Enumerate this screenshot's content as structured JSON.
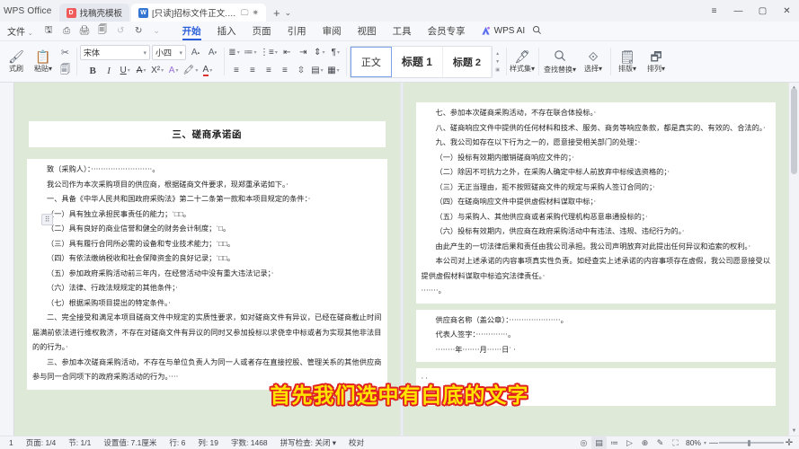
{
  "window": {
    "app_name": "WPS Office",
    "controls": {
      "minimize": "—",
      "maximize": "▢",
      "close": "✕",
      "menu": "≡"
    }
  },
  "tabs": [
    {
      "label": "找稿壳模板",
      "icon": "template-doc-icon",
      "kind": "pdfish",
      "active": false
    },
    {
      "label": "[只读]招标文件正文.docx",
      "icon": "word-doc-icon",
      "kind": "word",
      "active": true
    }
  ],
  "tab_actions": {
    "new_tab": "+",
    "tab_list": "⌄",
    "monitor": "🖵",
    "star": "✷"
  },
  "menu": {
    "file_label": "文件",
    "file_caret": "⌄",
    "quick_access": [
      {
        "name": "save-icon",
        "glyph": "🖫",
        "dim": false
      },
      {
        "name": "print-preview-icon",
        "glyph": "⎙",
        "dim": false
      },
      {
        "name": "print-icon",
        "glyph": "🖨",
        "dim": false
      },
      {
        "name": "print-direct-icon",
        "glyph": "🗐",
        "dim": false
      },
      {
        "name": "undo-icon",
        "glyph": "↺",
        "dim": true
      },
      {
        "name": "redo-icon",
        "glyph": "↻",
        "dim": false
      },
      {
        "name": "qat-more-icon",
        "glyph": "⌄",
        "dim": false
      }
    ],
    "ribbon_tabs": [
      {
        "label": "开始",
        "active": true
      },
      {
        "label": "插入",
        "active": false
      },
      {
        "label": "页面",
        "active": false
      },
      {
        "label": "引用",
        "active": false
      },
      {
        "label": "审阅",
        "active": false
      },
      {
        "label": "视图",
        "active": false
      },
      {
        "label": "工具",
        "active": false
      },
      {
        "label": "会员专享",
        "active": false
      }
    ],
    "ai": {
      "label": "WPS AI",
      "icon": "wps-ai-icon"
    },
    "search": {
      "icon": "search-icon",
      "glyph": "🔍"
    }
  },
  "ribbon": {
    "clipboard": {
      "format_brush": {
        "label": "式刷",
        "glyph": "🖌"
      },
      "paste": {
        "label": "粘贴",
        "glyph": "📋",
        "caret": "▾"
      },
      "cut": {
        "glyph": "✂"
      },
      "copy": {
        "glyph": "🗐"
      }
    },
    "font": {
      "family_value": "宋体",
      "size_value": "小四",
      "grow_glyph": "A",
      "shrink_glyph": "A",
      "buttons": [
        {
          "name": "bold-button",
          "glyph": "B"
        },
        {
          "name": "italic-button",
          "glyph": "I"
        },
        {
          "name": "underline-button",
          "glyph": "U"
        },
        {
          "name": "strikethrough-button",
          "glyph": "A"
        },
        {
          "name": "superscript-button",
          "glyph": "X²"
        },
        {
          "name": "text-effects-button",
          "glyph": "A"
        },
        {
          "name": "highlight-color-button",
          "glyph": "🖍"
        },
        {
          "name": "font-color-button",
          "glyph": "A"
        }
      ]
    },
    "paragraph": {
      "row1": [
        "≣",
        "≔",
        "⋮≡",
        "⇤",
        "⇥",
        "⇕",
        "¶"
      ],
      "row2": [
        "≡",
        "≡",
        "≡",
        "≡",
        "⇳",
        "▤",
        "▦"
      ]
    },
    "styles": {
      "items": [
        {
          "label": "正文",
          "selected": true
        },
        {
          "label": "标题 1",
          "selected": false
        },
        {
          "label": "标题 2",
          "selected": false
        }
      ],
      "scroll_up": "▲",
      "scroll_down": "▼",
      "scroll_more": "▣"
    },
    "right_tools": [
      {
        "label": "样式集",
        "glyph": "🖋",
        "caret": "▾",
        "name": "style-set-button"
      },
      {
        "label": "查找替换",
        "glyph": "🔍",
        "caret": "▾",
        "name": "find-replace-button"
      },
      {
        "label": "选择",
        "glyph": "⌖",
        "caret": "▾",
        "name": "select-button"
      },
      {
        "label": "排版",
        "glyph": "🗒",
        "caret": "▾",
        "name": "typeset-button"
      },
      {
        "label": "排列",
        "glyph": "🗗",
        "caret": "▾",
        "name": "arrange-button"
      }
    ]
  },
  "document": {
    "title": "三、磋商承诺函",
    "left_column": [
      "致（采购人）：·························。",
      "我公司作为本次采购项目的供应商，根据磋商文件要求，现郑重承诺如下。·",
      "一、具备《中华人民共和国政府采购法》第二十二条第一款和本项目规定的条件：·",
      "（一）具有独立承担民事责任的能力；˙□□。",
      "（二）具有良好的商业信誉和健全的财务会计制度；˙□。",
      "（三）具有履行合同所必需的设备和专业技术能力；˙□□。",
      "（四）有依法缴纳税收和社会保障资金的良好记录；˙□□。",
      "（五）参加政府采购活动前三年内，在经营活动中没有重大违法记录；·",
      "（六）法律、行政法规规定的其他条件；·",
      "（七）根据采购项目提出的特定条件。·",
      "二、完全接受和满足本项目磋商文件中规定的实质性要求，如对磋商文件有异议，已经在磋商截止时间届满前依法进行维权救济，不存在对磋商文件有异议的同时又参加投标以求侥幸中标或者为实现其他非法目的的行为。·",
      "三、参加本次磋商采购活动，不存在与单位负责人为同一人或者存在直接控股、管理关系的其他供应商参与同一合同项下的政府采购活动的行为。····"
    ],
    "right_column": [
      "七、参加本次磋商采购活动，不存在联合体投标。·",
      "八、磋商响应文件中提供的任何材料和技术、服务、商务等响应条款，都是真实的、有效的、合法的。·",
      "九、我公司如存在以下行为之一的，愿意接受相关部门的处理：·",
      "（一）投标有效期内撤销磋商响应文件的；·",
      "（二）除因不可抗力之外，在采购人确定中标人前放弃中标候选资格的；·",
      "（三）无正当理由，拒不按照磋商文件的规定与采购人签订合同的；·",
      "（四）在磋商响应文件中提供虚假材料谋取中标；·",
      "（五）与采购人、其他供应商或者采购代理机构恶意串通投标的；·",
      "（六）投标有效期内，供应商在政府采购活动中有违法、违规、违纪行为的。·",
      "由此产生的一切法律后果和责任由我公司承担。我公司声明放弃对此提出任何异议和追索的权利。·",
      "本公司对上述承诺的内容事项真实性负责。如经查实上述承诺的内容事项存在虚假，我公司愿意接受以提供虚假材料谋取中标追究法律责任。·",
      "·······。"
    ],
    "signature_lines": [
      "供应商名称（盖公章）：·····················。",
      "代表人签字：·············。",
      "········年·······月······日˙ ·"
    ],
    "trailing_marks": [
      "·  ·",
      "·  ·"
    ]
  },
  "statusbar": {
    "left": [
      {
        "name": "status-index",
        "label": "1"
      },
      {
        "name": "status-page",
        "label": "页面: 1/4"
      },
      {
        "name": "status-section",
        "label": "节: 1/1"
      },
      {
        "name": "status-setvalue",
        "label": "设置值: 7.1厘米"
      },
      {
        "name": "status-row",
        "label": "行: 6"
      },
      {
        "name": "status-col",
        "label": "列: 19"
      },
      {
        "name": "status-wordcount",
        "label": "字数: 1468"
      },
      {
        "name": "status-spellcheck",
        "label": "拼写检查: 关闭 ▾"
      },
      {
        "name": "status-proofread",
        "label": "校对"
      }
    ],
    "right_icons": [
      {
        "name": "eye-icon",
        "glyph": "◎",
        "boxed": false
      },
      {
        "name": "page-layout-view-icon",
        "glyph": "▤",
        "boxed": true
      },
      {
        "name": "outline-view-icon",
        "glyph": "≔",
        "boxed": false
      },
      {
        "name": "reading-view-icon",
        "glyph": "▷",
        "boxed": false
      },
      {
        "name": "web-layout-view-icon",
        "glyph": "⊕",
        "boxed": false
      },
      {
        "name": "ink-pen-icon",
        "glyph": "✎",
        "boxed": false
      },
      {
        "name": "fullscreen-icon",
        "glyph": "⛶",
        "boxed": false
      }
    ],
    "zoom": {
      "value": "80%",
      "caret": "▾",
      "minus": "—",
      "plus": "✛"
    }
  },
  "overlay": {
    "caption": "首先我们选中有白底的文字"
  },
  "colors": {
    "accent": "#2b5fd9",
    "page_bg": "#dfe9d8",
    "caption_fill": "#ffe400",
    "caption_stroke": "#e02020"
  }
}
